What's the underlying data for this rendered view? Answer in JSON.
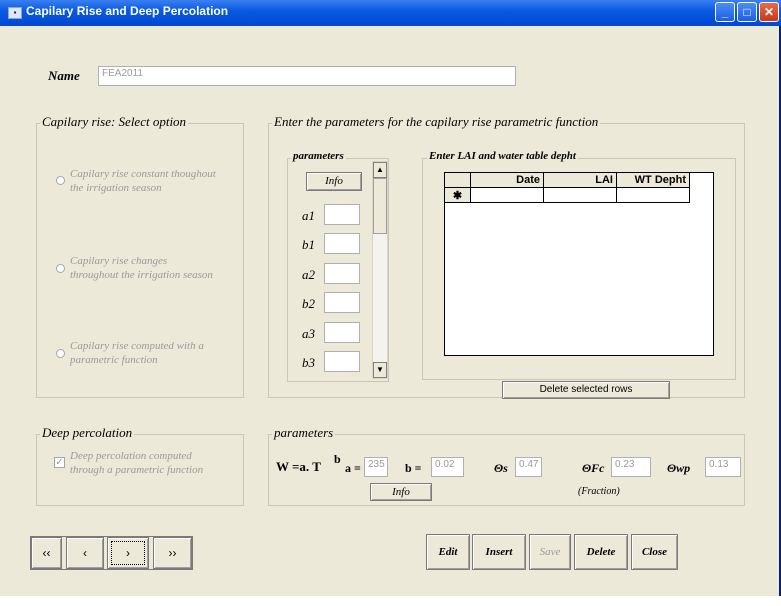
{
  "window": {
    "title": "Capilary Rise and Deep Percolation",
    "title_icon": "form-icon"
  },
  "name": {
    "label": "Name",
    "value": "FEA2011"
  },
  "capilary_group": {
    "legend": "Capilary rise: Select option",
    "options": [
      {
        "line1": "Capilary rise constant thoughout",
        "line2": "the irrigation season"
      },
      {
        "line1": "Capilary rise changes",
        "line2": "throughout the irrigation season"
      },
      {
        "line1": "Capilary rise computed with a",
        "line2": "parametric function"
      }
    ]
  },
  "params_group": {
    "legend": "Enter the parameters for the capilary rise parametric function"
  },
  "parameters_subgroup": {
    "legend": "parameters",
    "info_label": "Info",
    "labels": [
      "a1",
      "b1",
      "a2",
      "b2",
      "a3",
      "b3"
    ]
  },
  "lai_group": {
    "legend": "Enter LAI and water table depht",
    "columns": [
      "Date",
      "LAI",
      "WT Depht"
    ],
    "new_row_marker": "✱",
    "delete_button": "Delete selected rows"
  },
  "deep_group": {
    "legend": "Deep percolation",
    "checkbox_line1": "Deep percolation computed",
    "checkbox_line2": "through a parametric function",
    "checked": true
  },
  "deep_params": {
    "legend": "parameters",
    "formula": "W =a. T",
    "formula_exp": "b",
    "a_label": "a =",
    "a_value": "235",
    "b_label": "b =",
    "b_value": "0.02",
    "theta_s_label": "Θs",
    "theta_s_value": "0.47",
    "theta_fc_label": "ΘFc",
    "theta_fc_value": "0.23",
    "theta_wp_label": "Θwp",
    "theta_wp_value": "0.13",
    "info_label": "Info",
    "fraction_label": "(Fraction)"
  },
  "nav": {
    "first": "‹‹",
    "prev": "‹",
    "next": "›",
    "last": "››"
  },
  "actions": {
    "edit": "Edit",
    "insert": "Insert",
    "save": "Save",
    "delete": "Delete",
    "close": "Close"
  }
}
